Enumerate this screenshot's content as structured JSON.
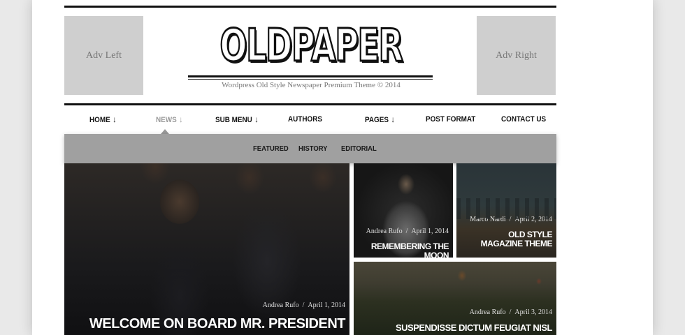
{
  "header": {
    "adv_left": "Adv Left",
    "adv_right": "Adv Right",
    "logo": "OLDPAPER",
    "tagline": "Wordpress Old Style Newspaper Premium Theme © 2014"
  },
  "nav": {
    "items": [
      {
        "label": "HOME",
        "arrow": "↓"
      },
      {
        "label": "NEWS",
        "arrow": "↓",
        "active": true
      },
      {
        "label": "SUB MENU",
        "arrow": "↓"
      },
      {
        "label": "AUTHORS",
        "arrow": ""
      },
      {
        "label": "PAGES",
        "arrow": "↓"
      },
      {
        "label": "POST FORMAT",
        "arrow": ""
      },
      {
        "label": "CONTACT US",
        "arrow": ""
      }
    ],
    "submenu": [
      "FEATURED",
      "HISTORY",
      "EDITORIAL"
    ]
  },
  "posts": [
    {
      "author": "Andrea Rufo",
      "separator": "/",
      "date": "April 1, 2014",
      "title": "WELCOME ON BOARD MR. PRESIDENT"
    },
    {
      "author": "Andrea Rufo",
      "separator": "/",
      "date": "April 1, 2014",
      "title": "REMEMBERING THE MOON"
    },
    {
      "author": "Marco Nardi",
      "separator": "/",
      "date": "April 2, 2014",
      "title": "OLD STYLE MAGAZINE THEME"
    },
    {
      "author": "Andrea Rufo",
      "separator": "/",
      "date": "April 3, 2014",
      "title": "SUSPENDISSE DICTUM FEUGIAT NISL"
    }
  ],
  "colors": {
    "page_bg": "#e9e9e9",
    "accent_dark": "#111111",
    "submenu_bg": "#a0a0a0",
    "adv_bg": "#cfcfcf"
  }
}
